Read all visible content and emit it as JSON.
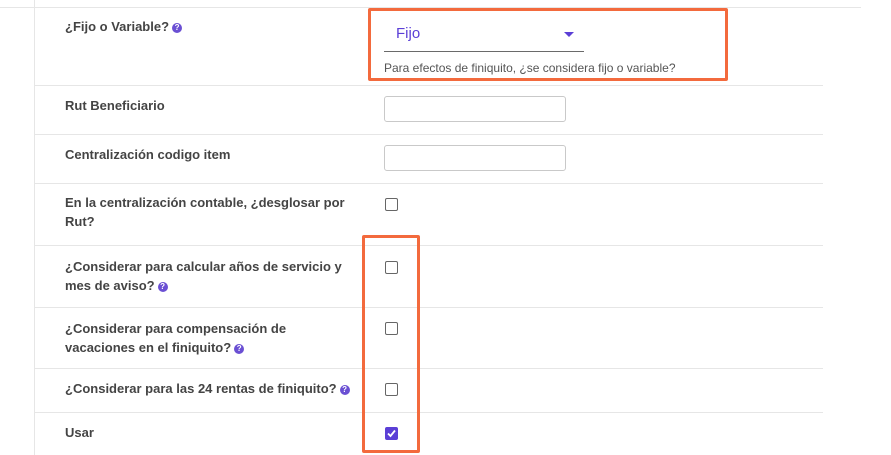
{
  "form": {
    "fijo_variable": {
      "label": "¿Fijo o Variable?",
      "value": "Fijo",
      "help_text": "Para efectos de finiquito, ¿se considera fijo o variable?"
    },
    "rut_beneficiario": {
      "label": "Rut Beneficiario",
      "value": ""
    },
    "centralizacion_codigo": {
      "label": "Centralización codigo item",
      "value": ""
    },
    "desglosar_rut": {
      "label": "En la centralización contable, ¿desglosar por Rut?",
      "checked": false
    },
    "anios_servicio": {
      "label": "¿Considerar para calcular años de servicio y mes de aviso?",
      "checked": false
    },
    "compensacion_vacaciones": {
      "label": "¿Considerar para compensación de vacaciones en el finiquito?",
      "checked": false
    },
    "rentas_24": {
      "label": "¿Considerar para las 24 rentas de finiquito?",
      "checked": false
    },
    "usar": {
      "label": "Usar",
      "checked": true
    }
  },
  "help_icon_glyph": "?",
  "colors": {
    "accent": "#5b3fd6",
    "highlight": "#f36a3d"
  }
}
